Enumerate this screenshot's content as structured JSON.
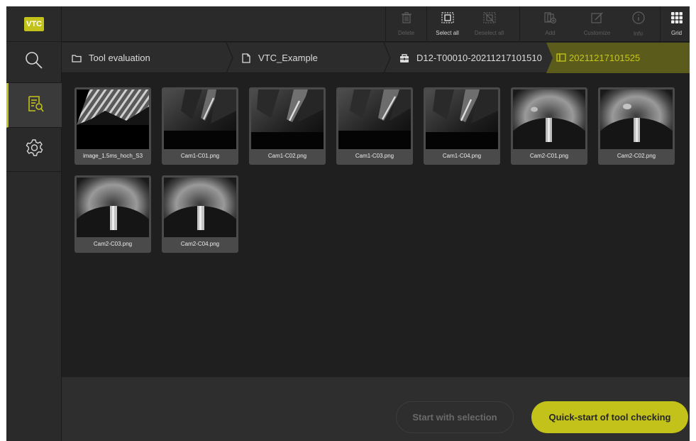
{
  "app": {
    "logo_text": "VTC",
    "accent_color": "#c2c21a"
  },
  "sidebar": {
    "items": [
      {
        "name": "search",
        "icon": "search-icon"
      },
      {
        "name": "tool-evaluation",
        "icon": "evaluation-icon",
        "active": true
      },
      {
        "name": "settings",
        "icon": "gear-icon"
      }
    ]
  },
  "toolbar": {
    "delete_label": "Delete",
    "select_all_label": "Select all",
    "deselect_all_label": "Deselect all",
    "add_label": "Add",
    "customize_label": "Customize",
    "info_label": "Info",
    "grid_label": "Grid"
  },
  "breadcrumb": {
    "items": [
      {
        "label": "Tool evaluation",
        "icon": "folder-icon"
      },
      {
        "label": "VTC_Example",
        "icon": "document-icon"
      },
      {
        "label": "D12-T00010-20211217101510",
        "icon": "toolbox-icon"
      },
      {
        "label": "20211217101525",
        "icon": "folder-icon",
        "active": true
      }
    ]
  },
  "images": [
    {
      "name": "image_1.5ms_hoch_S3"
    },
    {
      "name": "Cam1-C01.png"
    },
    {
      "name": "Cam1-C02.png"
    },
    {
      "name": "Cam1-C03.png"
    },
    {
      "name": "Cam1-C04.png"
    },
    {
      "name": "Cam2-C01.png"
    },
    {
      "name": "Cam2-C02.png"
    },
    {
      "name": "Cam2-C03.png"
    },
    {
      "name": "Cam2-C04.png"
    }
  ],
  "actions": {
    "start_selection_label": "Start with selection",
    "quickstart_label": "Quick-start of tool checking"
  }
}
